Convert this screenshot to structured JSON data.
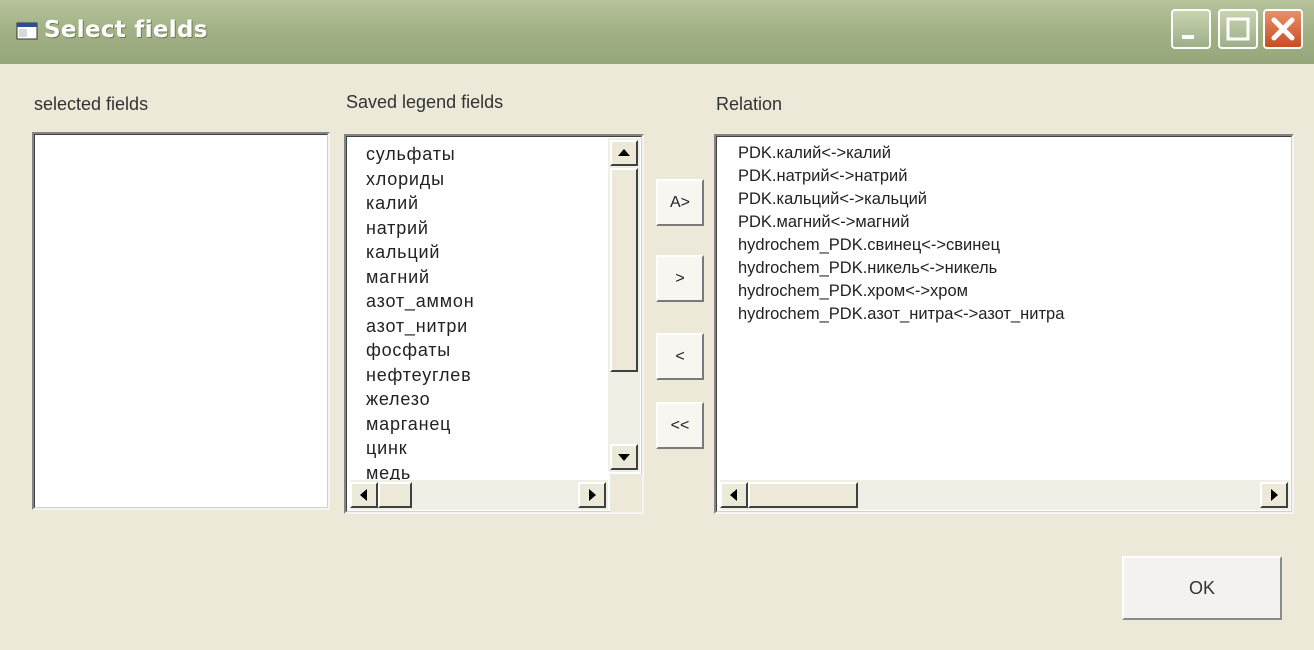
{
  "window": {
    "title": "Select fields"
  },
  "labels": {
    "selected": "selected fields",
    "saved": "Saved legend fields",
    "relation": "Relation"
  },
  "saved_fields": [
    "сульфаты",
    "хлориды",
    "калий",
    "натрий",
    "кальций",
    "магний",
    "азот_аммон",
    "азот_нитри",
    "фосфаты",
    "нефтеуглев",
    "железо",
    "марганец",
    "цинк",
    "медь"
  ],
  "relations": [
    "PDK.калий<->калий",
    "PDK.натрий<->натрий",
    "PDK.кальций<->кальций",
    "PDK.магний<->магний",
    "hydrochem_PDK.свинец<->свинец",
    "hydrochem_PDK.никель<->никель",
    "hydrochem_PDK.хром<->хром",
    "hydrochem_PDK.азот_нитра<->азот_нитра"
  ],
  "buttons": {
    "add_all": "A>",
    "add": ">",
    "remove": "<",
    "remove_all": "<<",
    "ok": "OK"
  },
  "icons": {
    "app": "window-app-icon",
    "minimize": "minimize-icon",
    "maximize": "maximize-icon",
    "close": "close-icon"
  }
}
